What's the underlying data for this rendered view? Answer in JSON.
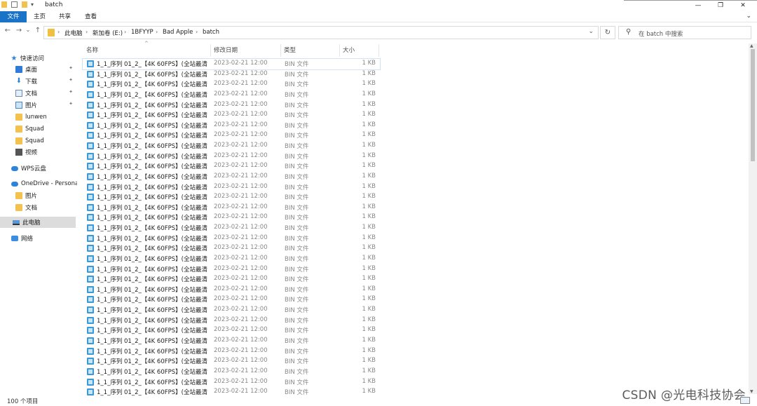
{
  "window": {
    "title": "batch"
  },
  "quick_access_toolbar": {
    "dropdown": "▾"
  },
  "window_controls": {
    "minimize": "—",
    "maximize": "❐",
    "close": "✕"
  },
  "ribbon": {
    "tabs": [
      {
        "label": "文件",
        "active": true
      },
      {
        "label": "主页"
      },
      {
        "label": "共享"
      },
      {
        "label": "查看"
      }
    ],
    "collapse": "⌄"
  },
  "navigation": {
    "back": "←",
    "forward": "→",
    "recent": "⌄",
    "up": "↑",
    "breadcrumbs": [
      "此电脑",
      "新加卷 (E:)",
      "1BFYYP",
      "Bad Apple",
      "batch"
    ],
    "separator": "›",
    "address_dropdown": "⌄",
    "refresh": "↻",
    "search_placeholder": "在 batch 中搜索"
  },
  "sidebar": {
    "items": [
      {
        "label": "快速访问",
        "icon": "star-icon"
      },
      {
        "label": "桌面",
        "icon": "desktop-icon",
        "pinned": true
      },
      {
        "label": "下载",
        "icon": "download-icon",
        "pinned": true
      },
      {
        "label": "文档",
        "icon": "document-icon",
        "pinned": true
      },
      {
        "label": "图片",
        "icon": "pictures-icon",
        "pinned": true
      },
      {
        "label": "lunwen",
        "icon": "folder-icon"
      },
      {
        "label": "Squad",
        "icon": "folder-icon"
      },
      {
        "label": "Squad",
        "icon": "folder-icon"
      },
      {
        "label": "视频",
        "icon": "video-icon"
      },
      {
        "label": "WPS云盘",
        "icon": "cloud-icon"
      },
      {
        "label": "OneDrive - Persona",
        "icon": "onedrive-icon"
      },
      {
        "label": "图片",
        "icon": "folder-icon"
      },
      {
        "label": "文档",
        "icon": "folder-icon"
      },
      {
        "label": "此电脑",
        "icon": "this-pc-icon",
        "selected": true
      },
      {
        "label": "网络",
        "icon": "network-icon"
      }
    ],
    "pin_glyph": "📌"
  },
  "file_list": {
    "columns": {
      "name": "名称",
      "date": "修改日期",
      "type": "类型",
      "size": "大小"
    },
    "sort_indicator": "^",
    "rows": [
      {
        "name": "1_1_序列 01_2_【4K 60FPS】(全站最清...",
        "date": "2023-02-21 12:00",
        "type": "BIN 文件",
        "size": "1 KB"
      },
      {
        "name": "1_1_序列 01_2_【4K 60FPS】(全站最清...",
        "date": "2023-02-21 12:00",
        "type": "BIN 文件",
        "size": "1 KB"
      },
      {
        "name": "1_1_序列 01_2_【4K 60FPS】(全站最清...",
        "date": "2023-02-21 12:00",
        "type": "BIN 文件",
        "size": "1 KB"
      },
      {
        "name": "1_1_序列 01_2_【4K 60FPS】(全站最清...",
        "date": "2023-02-21 12:00",
        "type": "BIN 文件",
        "size": "1 KB"
      },
      {
        "name": "1_1_序列 01_2_【4K 60FPS】(全站最清...",
        "date": "2023-02-21 12:00",
        "type": "BIN 文件",
        "size": "1 KB"
      },
      {
        "name": "1_1_序列 01_2_【4K 60FPS】(全站最清...",
        "date": "2023-02-21 12:00",
        "type": "BIN 文件",
        "size": "1 KB"
      },
      {
        "name": "1_1_序列 01_2_【4K 60FPS】(全站最清...",
        "date": "2023-02-21 12:00",
        "type": "BIN 文件",
        "size": "1 KB"
      },
      {
        "name": "1_1_序列 01_2_【4K 60FPS】(全站最清...",
        "date": "2023-02-21 12:00",
        "type": "BIN 文件",
        "size": "1 KB"
      },
      {
        "name": "1_1_序列 01_2_【4K 60FPS】(全站最清...",
        "date": "2023-02-21 12:00",
        "type": "BIN 文件",
        "size": "1 KB"
      },
      {
        "name": "1_1_序列 01_2_【4K 60FPS】(全站最清...",
        "date": "2023-02-21 12:00",
        "type": "BIN 文件",
        "size": "1 KB"
      },
      {
        "name": "1_1_序列 01_2_【4K 60FPS】(全站最清...",
        "date": "2023-02-21 12:00",
        "type": "BIN 文件",
        "size": "1 KB"
      },
      {
        "name": "1_1_序列 01_2_【4K 60FPS】(全站最清...",
        "date": "2023-02-21 12:00",
        "type": "BIN 文件",
        "size": "1 KB"
      },
      {
        "name": "1_1_序列 01_2_【4K 60FPS】(全站最清...",
        "date": "2023-02-21 12:00",
        "type": "BIN 文件",
        "size": "1 KB"
      },
      {
        "name": "1_1_序列 01_2_【4K 60FPS】(全站最清...",
        "date": "2023-02-21 12:00",
        "type": "BIN 文件",
        "size": "1 KB"
      },
      {
        "name": "1_1_序列 01_2_【4K 60FPS】(全站最清...",
        "date": "2023-02-21 12:00",
        "type": "BIN 文件",
        "size": "1 KB"
      },
      {
        "name": "1_1_序列 01_2_【4K 60FPS】(全站最清...",
        "date": "2023-02-21 12:00",
        "type": "BIN 文件",
        "size": "1 KB"
      },
      {
        "name": "1_1_序列 01_2_【4K 60FPS】(全站最清...",
        "date": "2023-02-21 12:00",
        "type": "BIN 文件",
        "size": "1 KB"
      },
      {
        "name": "1_1_序列 01_2_【4K 60FPS】(全站最清...",
        "date": "2023-02-21 12:00",
        "type": "BIN 文件",
        "size": "1 KB"
      },
      {
        "name": "1_1_序列 01_2_【4K 60FPS】(全站最清...",
        "date": "2023-02-21 12:00",
        "type": "BIN 文件",
        "size": "1 KB"
      },
      {
        "name": "1_1_序列 01_2_【4K 60FPS】(全站最清...",
        "date": "2023-02-21 12:00",
        "type": "BIN 文件",
        "size": "1 KB"
      },
      {
        "name": "1_1_序列 01_2_【4K 60FPS】(全站最清...",
        "date": "2023-02-21 12:00",
        "type": "BIN 文件",
        "size": "1 KB"
      },
      {
        "name": "1_1_序列 01_2_【4K 60FPS】(全站最清...",
        "date": "2023-02-21 12:00",
        "type": "BIN 文件",
        "size": "1 KB"
      },
      {
        "name": "1_1_序列 01_2_【4K 60FPS】(全站最清...",
        "date": "2023-02-21 12:00",
        "type": "BIN 文件",
        "size": "1 KB"
      },
      {
        "name": "1_1_序列 01_2_【4K 60FPS】(全站最清...",
        "date": "2023-02-21 12:00",
        "type": "BIN 文件",
        "size": "1 KB"
      },
      {
        "name": "1_1_序列 01_2_【4K 60FPS】(全站最清...",
        "date": "2023-02-21 12:00",
        "type": "BIN 文件",
        "size": "1 KB"
      },
      {
        "name": "1_1_序列 01_2_【4K 60FPS】(全站最清...",
        "date": "2023-02-21 12:00",
        "type": "BIN 文件",
        "size": "1 KB"
      },
      {
        "name": "1_1_序列 01_2_【4K 60FPS】(全站最清...",
        "date": "2023-02-21 12:00",
        "type": "BIN 文件",
        "size": "1 KB"
      },
      {
        "name": "1_1_序列 01_2_【4K 60FPS】(全站最清...",
        "date": "2023-02-21 12:00",
        "type": "BIN 文件",
        "size": "1 KB"
      },
      {
        "name": "1_1_序列 01_2_【4K 60FPS】(全站最清...",
        "date": "2023-02-21 12:00",
        "type": "BIN 文件",
        "size": "1 KB"
      },
      {
        "name": "1_1_序列 01_2_【4K 60FPS】(全站最清...",
        "date": "2023-02-21 12:00",
        "type": "BIN 文件",
        "size": "1 KB"
      },
      {
        "name": "1_1_序列 01_2_【4K 60FPS】(全站最清...",
        "date": "2023-02-21 12:00",
        "type": "BIN 文件",
        "size": "1 KB"
      },
      {
        "name": "1_1_序列 01_2_【4K 60FPS】(全站最清...",
        "date": "2023-02-21 12:00",
        "type": "BIN 文件",
        "size": "1 KB"
      },
      {
        "name": "1_1_序列 01_2_【4K 60FPS】(全站最清...",
        "date": "2023-02-21 12:00",
        "type": "BIN 文件",
        "size": "1 KB"
      }
    ]
  },
  "status_bar": {
    "item_count": "100 个项目"
  },
  "watermark": "CSDN @光电科技协会",
  "colors": {
    "accent": "#1a73c7",
    "selected": "#dcdcdc",
    "folder": "#f2c14e"
  }
}
